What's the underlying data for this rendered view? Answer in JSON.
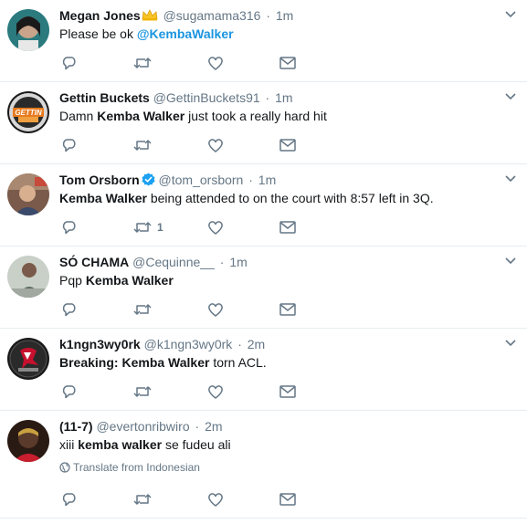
{
  "tweets": [
    {
      "name": "Megan Jones",
      "badge": "crown",
      "handle": "@sugamama316",
      "time": "1m",
      "text_pre": "Please be ok ",
      "text_bold": "@KembaWalker",
      "text_post": "",
      "bold_style": "mention",
      "retweets": ""
    },
    {
      "name": "Gettin Buckets",
      "badge": "",
      "handle": "@GettinBuckets91",
      "time": "1m",
      "text_pre": "Damn ",
      "text_bold": "Kemba Walker",
      "text_post": " just took a really hard hit",
      "bold_style": "bold",
      "retweets": ""
    },
    {
      "name": "Tom Orsborn",
      "badge": "verified",
      "handle": "@tom_orsborn",
      "time": "1m",
      "text_pre": "",
      "text_bold": "Kemba Walker",
      "text_post": " being attended to on the court with 8:57 left in 3Q.",
      "bold_style": "bold",
      "retweets": "1"
    },
    {
      "name": "SÓ CHAMA",
      "badge": "",
      "handle": "@Cequinne__",
      "time": "1m",
      "text_pre": "Pqp ",
      "text_bold": "Kemba Walker",
      "text_post": "",
      "bold_style": "bold",
      "retweets": ""
    },
    {
      "name": "k1ngn3wy0rk",
      "badge": "",
      "handle": "@k1ngn3wy0rk",
      "time": "2m",
      "text_pre_bold": "Breaking:",
      "text_pre": " ",
      "text_bold": "Kemba Walker",
      "text_post": " torn ACL.",
      "bold_style": "bold",
      "retweets": ""
    },
    {
      "name": "(11-7)",
      "badge": "",
      "handle": "@evertonribwiro",
      "time": "2m",
      "text_pre": "xiii ",
      "text_bold": "kemba walker",
      "text_post": " se fudeu ali",
      "bold_style": "bold",
      "translate": "Translate from Indonesian",
      "retweets": ""
    }
  ],
  "separator": "·",
  "icons": {
    "reply": "reply-icon",
    "retweet": "retweet-icon",
    "like": "heart-icon",
    "dm": "envelope-icon",
    "more": "chevron-down-icon",
    "translate": "globe-icon"
  },
  "colors": {
    "text": "#14171a",
    "muted": "#657786",
    "link": "#1b95e0",
    "border": "#e6ecf0",
    "verified": "#1da1f2"
  }
}
